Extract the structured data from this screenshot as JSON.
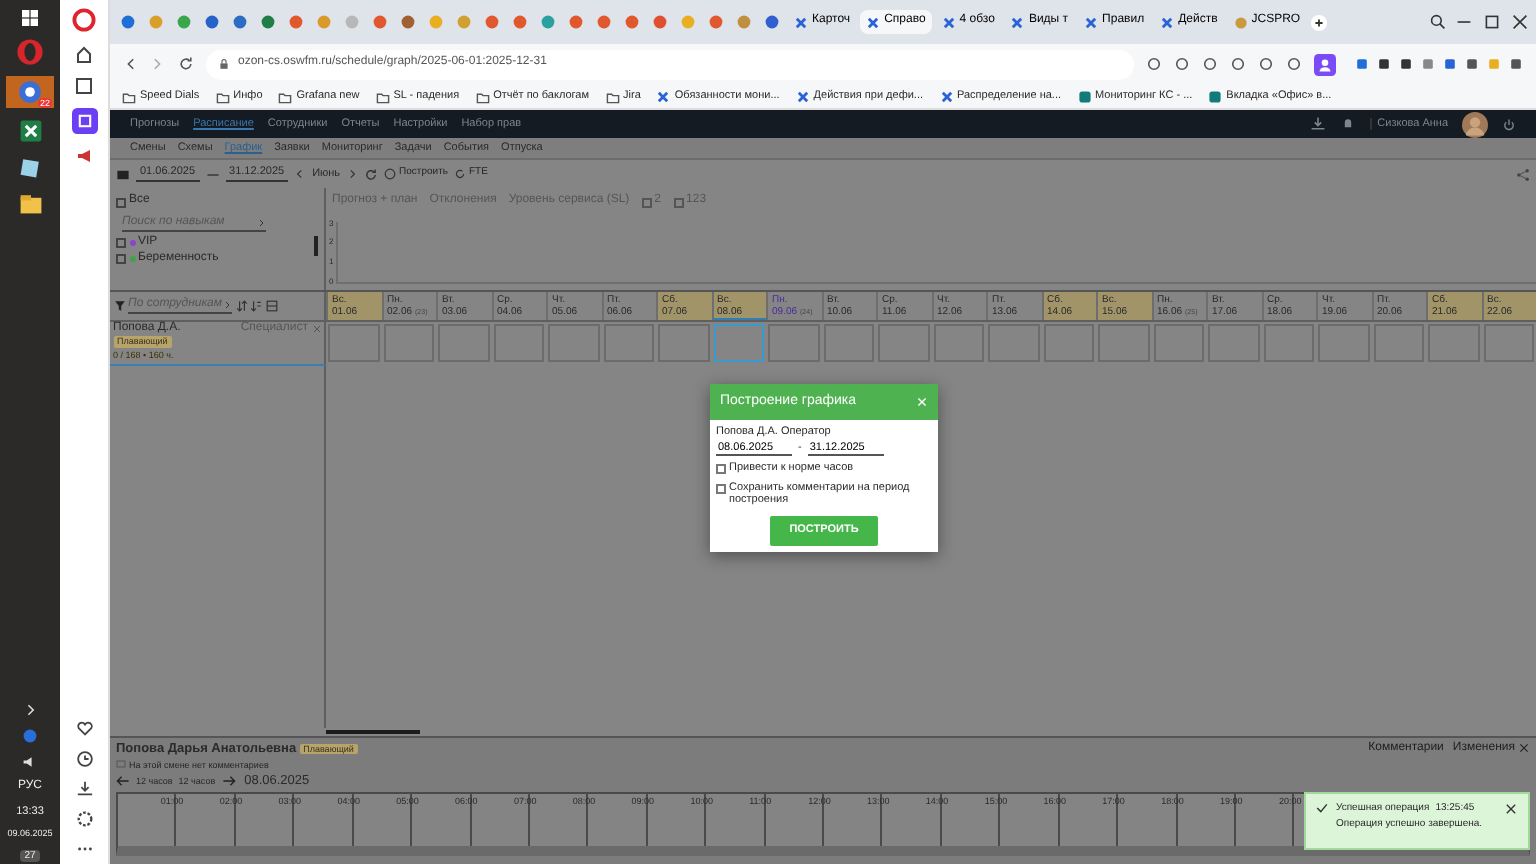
{
  "taskbar": {
    "badge": "22",
    "language": "РУС",
    "time": "13:33",
    "date": "09.06.2025",
    "notifications": "27"
  },
  "browser": {
    "tabs": [
      {
        "label": "Карточ",
        "selected": false
      },
      {
        "label": "Справо",
        "selected": true
      },
      {
        "label": "4 обзо",
        "selected": false
      },
      {
        "label": "Виды т",
        "selected": false
      },
      {
        "label": "Правил",
        "selected": false
      },
      {
        "label": "Действ",
        "selected": false
      },
      {
        "label": "JCSPRO",
        "selected": false
      }
    ],
    "url": "ozon-cs.oswfm.ru/schedule/graph/2025-06-01:2025-12-31",
    "bookmarks": [
      {
        "label": "Speed Dials",
        "kind": "folder"
      },
      {
        "label": "Инфо",
        "kind": "folder"
      },
      {
        "label": "Grafana new",
        "kind": "folder"
      },
      {
        "label": "SL - падения",
        "kind": "folder"
      },
      {
        "label": "Отчёт по баклогам",
        "kind": "folder"
      },
      {
        "label": "Jira",
        "kind": "folder"
      },
      {
        "label": "Обязанности мони...",
        "kind": "page"
      },
      {
        "label": "Действия при дефи...",
        "kind": "page"
      },
      {
        "label": "Распределение на...",
        "kind": "page"
      },
      {
        "label": "Мониторинг КС - ...",
        "kind": "site"
      },
      {
        "label": "Вкладка «Офис» в...",
        "kind": "site"
      }
    ]
  },
  "app": {
    "nav": [
      {
        "label": "Прогнозы",
        "selected": false
      },
      {
        "label": "Расписание",
        "selected": true
      },
      {
        "label": "Сотрудники",
        "selected": false
      },
      {
        "label": "Отчеты",
        "selected": false
      },
      {
        "label": "Настройки",
        "selected": false
      },
      {
        "label": "Набор прав",
        "selected": false
      }
    ],
    "user": "Сизкова Анна",
    "subnav": [
      {
        "label": "Смены",
        "selected": false
      },
      {
        "label": "Схемы",
        "selected": false
      },
      {
        "label": "График",
        "selected": true
      },
      {
        "label": "Заявки",
        "selected": false
      },
      {
        "label": "Мониторинг",
        "selected": false
      },
      {
        "label": "Задачи",
        "selected": false
      },
      {
        "label": "События",
        "selected": false
      },
      {
        "label": "Отпуска",
        "selected": false
      }
    ],
    "toolbar": {
      "date_from": "01.06.2025",
      "date_to": "31.12.2025",
      "month": "Июнь",
      "build": "Построить",
      "fte": "FTE"
    },
    "all_checkbox": {
      "label": "Все",
      "checked": false
    },
    "chart_tabs": [
      "Прогноз + план",
      "Отклонения",
      "Уровень сервиса (SL)"
    ],
    "chart_options": [
      {
        "label": "2",
        "checked": false
      },
      {
        "label": "123",
        "checked": false
      }
    ],
    "skill_search": {
      "placeholder": "Поиск по навыкам"
    },
    "filters": [
      {
        "label": "VIP",
        "color": "#8e44c8",
        "checked": false
      },
      {
        "label": "Беременность",
        "color": "#3fa34a",
        "checked": false
      }
    ],
    "y_ticks": [
      "3",
      "2",
      "1",
      "0"
    ],
    "employee_search": {
      "placeholder": "По сотрудникам"
    },
    "days": [
      {
        "weekday": "Вс.",
        "date": "01.06",
        "weekend": true,
        "today": false,
        "selected": false
      },
      {
        "weekday": "Пн.",
        "date": "02.06",
        "week": "(23)",
        "weekend": false,
        "today": false,
        "selected": false
      },
      {
        "weekday": "Вт.",
        "date": "03.06",
        "weekend": false,
        "today": false,
        "selected": false
      },
      {
        "weekday": "Ср.",
        "date": "04.06",
        "weekend": false,
        "today": false,
        "selected": false
      },
      {
        "weekday": "Чт.",
        "date": "05.06",
        "weekend": false,
        "today": false,
        "selected": false
      },
      {
        "weekday": "Пт.",
        "date": "06.06",
        "weekend": false,
        "today": false,
        "selected": false
      },
      {
        "weekday": "Сб.",
        "date": "07.06",
        "weekend": true,
        "today": false,
        "selected": false
      },
      {
        "weekday": "Вс.",
        "date": "08.06",
        "weekend": true,
        "today": false,
        "selected": true
      },
      {
        "weekday": "Пн.",
        "date": "09.06",
        "week": "(24)",
        "weekend": false,
        "today": true,
        "selected": false
      },
      {
        "weekday": "Вт.",
        "date": "10.06",
        "weekend": false,
        "today": false,
        "selected": false
      },
      {
        "weekday": "Ср.",
        "date": "11.06",
        "weekend": false,
        "today": false,
        "selected": false
      },
      {
        "weekday": "Чт.",
        "date": "12.06",
        "weekend": false,
        "today": false,
        "selected": false
      },
      {
        "weekday": "Пт.",
        "date": "13.06",
        "weekend": false,
        "today": false,
        "selected": false
      },
      {
        "weekday": "Сб.",
        "date": "14.06",
        "weekend": true,
        "today": false,
        "selected": false
      },
      {
        "weekday": "Вс.",
        "date": "15.06",
        "weekend": true,
        "today": false,
        "selected": false
      },
      {
        "weekday": "Пн.",
        "date": "16.06",
        "week": "(25)",
        "weekend": false,
        "today": false,
        "selected": false
      },
      {
        "weekday": "Вт.",
        "date": "17.06",
        "weekend": false,
        "today": false,
        "selected": false
      },
      {
        "weekday": "Ср.",
        "date": "18.06",
        "weekend": false,
        "today": false,
        "selected": false
      },
      {
        "weekday": "Чт.",
        "date": "19.06",
        "weekend": false,
        "today": false,
        "selected": false
      },
      {
        "weekday": "Пт.",
        "date": "20.06",
        "weekend": false,
        "today": false,
        "selected": false
      },
      {
        "weekday": "Сб.",
        "date": "21.06",
        "weekend": true,
        "today": false,
        "selected": false
      },
      {
        "weekday": "Вс.",
        "date": "22.06",
        "weekend": true,
        "today": false,
        "selected": false
      }
    ],
    "employee": {
      "name": "Попова Д.А.",
      "role": "Специалист",
      "tag": "Плавающий",
      "hours": "0 / 168 • 160 ч."
    }
  },
  "details": {
    "name": "Попова Дарья Анатольевна",
    "tag": "Плавающий",
    "comment": "На этой смене нет комментариев",
    "prev": "12 часов",
    "next": "12 часов",
    "date": "08.06.2025",
    "tabs": [
      "Комментарии",
      "Изменения"
    ],
    "hours": [
      "01:00",
      "02:00",
      "03:00",
      "04:00",
      "05:00",
      "06:00",
      "07:00",
      "08:00",
      "09:00",
      "10:00",
      "11:00",
      "12:00",
      "13:00",
      "14:00",
      "15:00",
      "16:00",
      "17:00",
      "18:00",
      "19:00",
      "20:00"
    ]
  },
  "dialog": {
    "title": "Построение графика",
    "employee": "Попова Д.А. Оператор",
    "date_from": "08.06.2025",
    "date_to": "31.12.2025",
    "separator": "-",
    "options": [
      {
        "label": "Привести к норме часов",
        "checked": false
      },
      {
        "label": "Сохранить комментарии на период построения",
        "checked": false
      }
    ],
    "button": "ПОСТРОИТЬ"
  },
  "toast": {
    "title": "Успешная операция",
    "time": "13:25:45",
    "message": "Операция успешно завершена."
  }
}
